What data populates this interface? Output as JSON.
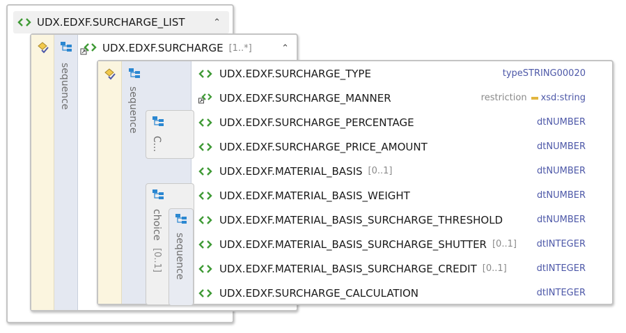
{
  "list": {
    "title": "UDX.EDXF.SURCHARGE_LIST"
  },
  "surcharge": {
    "title": "UDX.EDXF.SURCHARGE",
    "multiplicity": "[1..*]",
    "compositor": "sequence"
  },
  "inner": {
    "compositor": "sequence",
    "choice_abbrev": "C...",
    "choice_label": "choice",
    "choice_multiplicity": "[0..1]",
    "choice_sequence": "sequence"
  },
  "elements": [
    {
      "name": "UDX.EDXF.SURCHARGE_TYPE",
      "multiplicity": "",
      "type": "typeSTRING00020",
      "prefix": "",
      "icon": "element-icon"
    },
    {
      "name": "UDX.EDXF.SURCHARGE_MANNER",
      "multiplicity": "",
      "type": "xsd:string",
      "prefix": "restriction",
      "icon": "restriction-element-icon"
    },
    {
      "name": "UDX.EDXF.SURCHARGE_PERCENTAGE",
      "multiplicity": "",
      "type": "dtNUMBER",
      "prefix": "",
      "icon": "element-icon"
    },
    {
      "name": "UDX.EDXF.SURCHARGE_PRICE_AMOUNT",
      "multiplicity": "",
      "type": "dtNUMBER",
      "prefix": "",
      "icon": "element-icon"
    },
    {
      "name": "UDX.EDXF.MATERIAL_BASIS",
      "multiplicity": "[0..1]",
      "type": "dtNUMBER",
      "prefix": "",
      "icon": "element-icon"
    },
    {
      "name": "UDX.EDXF.MATERIAL_BASIS_WEIGHT",
      "multiplicity": "",
      "type": "dtNUMBER",
      "prefix": "",
      "icon": "element-icon"
    },
    {
      "name": "UDX.EDXF.MATERIAL_BASIS_SURCHARGE_THRESHOLD",
      "multiplicity": "",
      "type": "dtNUMBER",
      "prefix": "",
      "icon": "element-icon"
    },
    {
      "name": "UDX.EDXF.MATERIAL_BASIS_SURCHARGE_SHUTTER",
      "multiplicity": "[0..1]",
      "type": "dtINTEGER",
      "prefix": "",
      "icon": "element-icon"
    },
    {
      "name": "UDX.EDXF.MATERIAL_BASIS_SURCHARGE_CREDIT",
      "multiplicity": "[0..1]",
      "type": "dtINTEGER",
      "prefix": "",
      "icon": "element-icon"
    },
    {
      "name": "UDX.EDXF.SURCHARGE_CALCULATION",
      "multiplicity": "",
      "type": "dtINTEGER",
      "prefix": "",
      "icon": "element-icon"
    }
  ],
  "colors": {
    "type_text": "#4d58a8",
    "element_icon": "#3f9a35",
    "restriction_marker": "#e2b640"
  }
}
